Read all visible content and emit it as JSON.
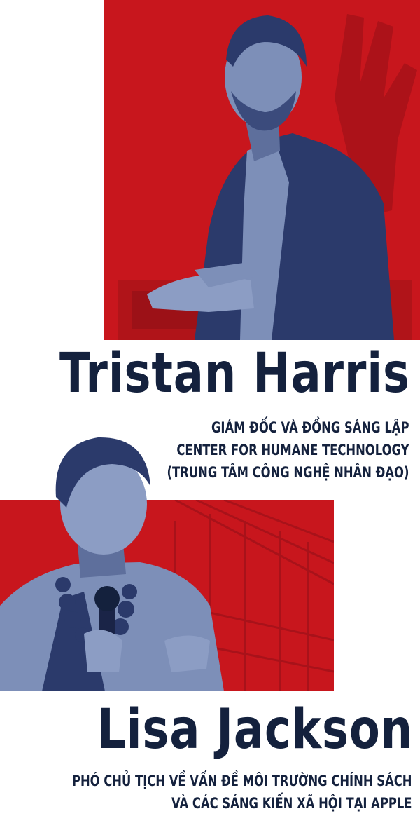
{
  "people": [
    {
      "name": "Tristan Harris",
      "role_lines": [
        "GIÁM ĐỐC VÀ ĐỒNG SÁNG LẬP",
        "CENTER FOR HUMANE TECHNOLOGY",
        "(TRUNG TÂM CÔNG NGHỆ NHÂN ĐẠO)"
      ]
    },
    {
      "name": "Lisa Jackson",
      "role_lines": [
        "PHÓ CHỦ TỊCH VỀ VẤN ĐỀ MÔI TRƯỜNG CHÍNH SÁCH",
        "VÀ CÁC SÁNG KIẾN XÃ HỘI TẠI APPLE"
      ]
    }
  ],
  "colors": {
    "accent_red": "#c8161d",
    "navy": "#14213d",
    "photo_tint": "#7d8fb8"
  }
}
